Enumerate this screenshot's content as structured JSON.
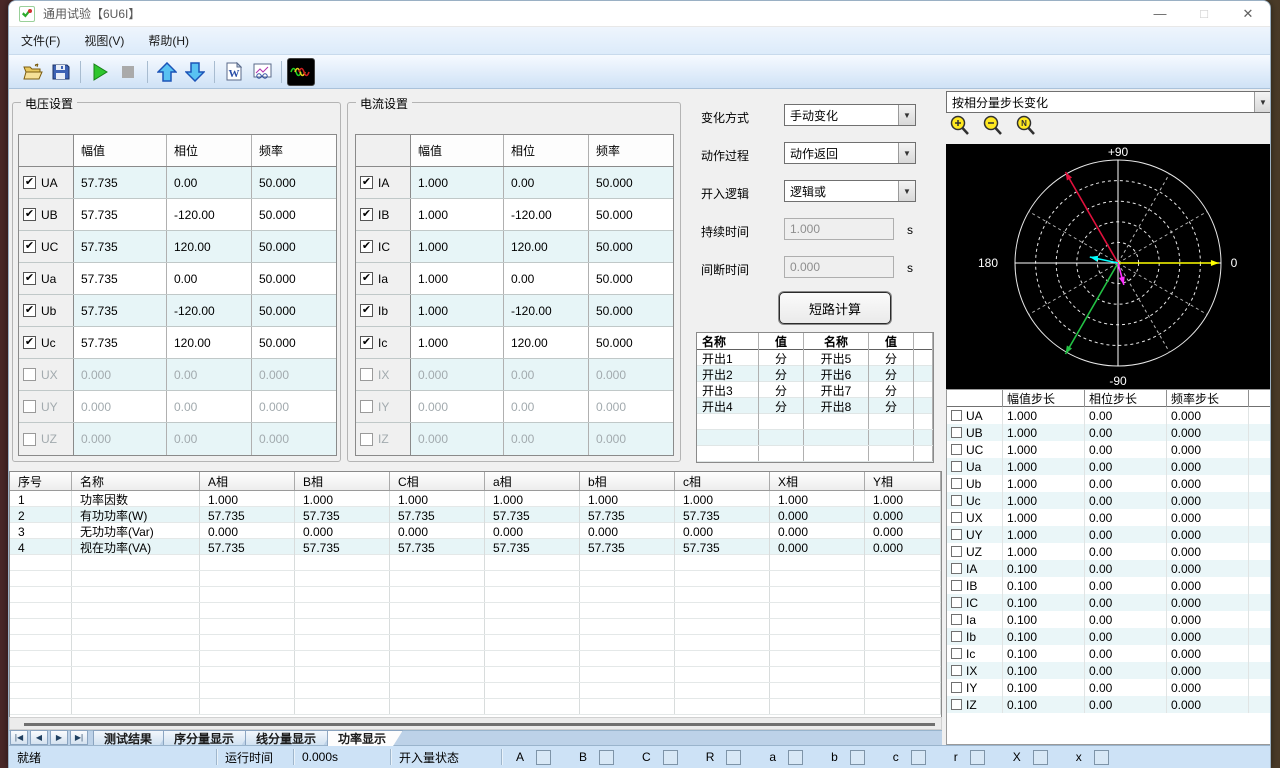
{
  "window": {
    "title": "通用试验【6U6I】",
    "minimize": "—",
    "maximize": "□",
    "close": "✕"
  },
  "menu": {
    "items": [
      "文件(F)",
      "视图(V)",
      "帮助(H)"
    ]
  },
  "toolbar": {
    "icons": [
      "open",
      "save",
      "start",
      "stop",
      "move-up",
      "move-down",
      "word-report",
      "report-view",
      "waveform"
    ]
  },
  "voltage": {
    "group_title": "电压设置",
    "headers": [
      "幅值",
      "相位",
      "频率"
    ],
    "rows": [
      {
        "name": "UA",
        "checked": true,
        "amp": "57.735",
        "phase": "0.00",
        "freq": "50.000"
      },
      {
        "name": "UB",
        "checked": true,
        "amp": "57.735",
        "phase": "-120.00",
        "freq": "50.000"
      },
      {
        "name": "UC",
        "checked": true,
        "amp": "57.735",
        "phase": "120.00",
        "freq": "50.000"
      },
      {
        "name": "Ua",
        "checked": true,
        "amp": "57.735",
        "phase": "0.00",
        "freq": "50.000"
      },
      {
        "name": "Ub",
        "checked": true,
        "amp": "57.735",
        "phase": "-120.00",
        "freq": "50.000"
      },
      {
        "name": "Uc",
        "checked": true,
        "amp": "57.735",
        "phase": "120.00",
        "freq": "50.000"
      },
      {
        "name": "UX",
        "checked": false,
        "amp": "0.000",
        "phase": "0.00",
        "freq": "0.000"
      },
      {
        "name": "UY",
        "checked": false,
        "amp": "0.000",
        "phase": "0.00",
        "freq": "0.000"
      },
      {
        "name": "UZ",
        "checked": false,
        "amp": "0.000",
        "phase": "0.00",
        "freq": "0.000"
      }
    ]
  },
  "current": {
    "group_title": "电流设置",
    "headers": [
      "幅值",
      "相位",
      "频率"
    ],
    "rows": [
      {
        "name": "IA",
        "checked": true,
        "amp": "1.000",
        "phase": "0.00",
        "freq": "50.000"
      },
      {
        "name": "IB",
        "checked": true,
        "amp": "1.000",
        "phase": "-120.00",
        "freq": "50.000"
      },
      {
        "name": "IC",
        "checked": true,
        "amp": "1.000",
        "phase": "120.00",
        "freq": "50.000"
      },
      {
        "name": "Ia",
        "checked": true,
        "amp": "1.000",
        "phase": "0.00",
        "freq": "50.000"
      },
      {
        "name": "Ib",
        "checked": true,
        "amp": "1.000",
        "phase": "-120.00",
        "freq": "50.000"
      },
      {
        "name": "Ic",
        "checked": true,
        "amp": "1.000",
        "phase": "120.00",
        "freq": "50.000"
      },
      {
        "name": "IX",
        "checked": false,
        "amp": "0.000",
        "phase": "0.00",
        "freq": "0.000"
      },
      {
        "name": "IY",
        "checked": false,
        "amp": "0.000",
        "phase": "0.00",
        "freq": "0.000"
      },
      {
        "name": "IZ",
        "checked": false,
        "amp": "0.000",
        "phase": "0.00",
        "freq": "0.000"
      }
    ]
  },
  "controls": {
    "change_mode_label": "变化方式",
    "change_mode_value": "手动变化",
    "action_process_label": "动作过程",
    "action_process_value": "动作返回",
    "di_logic_label": "开入逻辑",
    "di_logic_value": "逻辑或",
    "duration_label": "持续时间",
    "duration_value": "1.000",
    "duration_unit": "s",
    "interval_label": "间断时间",
    "interval_value": "0.000",
    "interval_unit": "s",
    "calc_button": "短路计算"
  },
  "do_table": {
    "headers": [
      "名称",
      "值",
      "名称",
      "值"
    ],
    "rows": [
      [
        "开出1",
        "分",
        "开出5",
        "分"
      ],
      [
        "开出2",
        "分",
        "开出6",
        "分"
      ],
      [
        "开出3",
        "分",
        "开出7",
        "分"
      ],
      [
        "开出4",
        "分",
        "开出8",
        "分"
      ],
      [
        "",
        "",
        "",
        ""
      ],
      [
        "",
        "",
        "",
        ""
      ],
      [
        "",
        "",
        "",
        ""
      ]
    ]
  },
  "right_panel": {
    "dropdown_value": "按相分量步长变化",
    "zoom_icons": [
      "zoom-in",
      "zoom-out",
      "zoom-reset"
    ]
  },
  "chart_data": {
    "type": "phasor-polar",
    "axis_labels": {
      "top": "+90",
      "bottom": "-90",
      "left": "180",
      "right": "0"
    },
    "grid": {
      "dashed_rings": 4,
      "radial_step_deg": 30
    },
    "vectors": [
      {
        "name": "voltage-yellow",
        "color": "#ffff00",
        "angle_deg": 0,
        "magnitude": 57.735,
        "length_frac": 0.49
      },
      {
        "name": "voltage-red",
        "color": "#e0103c",
        "angle_deg": 120,
        "magnitude": 57.735,
        "length_frac": 0.51
      },
      {
        "name": "voltage-green",
        "color": "#22c244",
        "angle_deg": -120,
        "magnitude": 57.735,
        "length_frac": 0.51
      },
      {
        "name": "current-cyan",
        "color": "#00ffff",
        "angle_deg": 168,
        "magnitude": 1.0,
        "length_frac": 0.14
      },
      {
        "name": "current-magenta",
        "color": "#ff30ff",
        "angle_deg": -75,
        "magnitude": 1.0,
        "length_frac": 0.11
      }
    ]
  },
  "step_table": {
    "headers": [
      "幅值步长",
      "相位步长",
      "频率步长"
    ],
    "rows": [
      {
        "name": "UA",
        "amp": "1.000",
        "phase": "0.00",
        "freq": "0.000"
      },
      {
        "name": "UB",
        "amp": "1.000",
        "phase": "0.00",
        "freq": "0.000"
      },
      {
        "name": "UC",
        "amp": "1.000",
        "phase": "0.00",
        "freq": "0.000"
      },
      {
        "name": "Ua",
        "amp": "1.000",
        "phase": "0.00",
        "freq": "0.000"
      },
      {
        "name": "Ub",
        "amp": "1.000",
        "phase": "0.00",
        "freq": "0.000"
      },
      {
        "name": "Uc",
        "amp": "1.000",
        "phase": "0.00",
        "freq": "0.000"
      },
      {
        "name": "UX",
        "amp": "1.000",
        "phase": "0.00",
        "freq": "0.000"
      },
      {
        "name": "UY",
        "amp": "1.000",
        "phase": "0.00",
        "freq": "0.000"
      },
      {
        "name": "UZ",
        "amp": "1.000",
        "phase": "0.00",
        "freq": "0.000"
      },
      {
        "name": "IA",
        "amp": "0.100",
        "phase": "0.00",
        "freq": "0.000"
      },
      {
        "name": "IB",
        "amp": "0.100",
        "phase": "0.00",
        "freq": "0.000"
      },
      {
        "name": "IC",
        "amp": "0.100",
        "phase": "0.00",
        "freq": "0.000"
      },
      {
        "name": "Ia",
        "amp": "0.100",
        "phase": "0.00",
        "freq": "0.000"
      },
      {
        "name": "Ib",
        "amp": "0.100",
        "phase": "0.00",
        "freq": "0.000"
      },
      {
        "name": "Ic",
        "amp": "0.100",
        "phase": "0.00",
        "freq": "0.000"
      },
      {
        "name": "IX",
        "amp": "0.100",
        "phase": "0.00",
        "freq": "0.000"
      },
      {
        "name": "IY",
        "amp": "0.100",
        "phase": "0.00",
        "freq": "0.000"
      },
      {
        "name": "IZ",
        "amp": "0.100",
        "phase": "0.00",
        "freq": "0.000"
      }
    ]
  },
  "power_table": {
    "headers": [
      "序号",
      "名称",
      "A相",
      "B相",
      "C相",
      "a相",
      "b相",
      "c相",
      "X相",
      "Y相"
    ],
    "rows": [
      [
        "1",
        "功率因数",
        "1.000",
        "1.000",
        "1.000",
        "1.000",
        "1.000",
        "1.000",
        "1.000",
        "1.000"
      ],
      [
        "2",
        "有功功率(W)",
        "57.735",
        "57.735",
        "57.735",
        "57.735",
        "57.735",
        "57.735",
        "0.000",
        "0.000"
      ],
      [
        "3",
        "无功功率(Var)",
        "0.000",
        "0.000",
        "0.000",
        "0.000",
        "0.000",
        "0.000",
        "0.000",
        "0.000"
      ],
      [
        "4",
        "视在功率(VA)",
        "57.735",
        "57.735",
        "57.735",
        "57.735",
        "57.735",
        "57.735",
        "0.000",
        "0.000"
      ]
    ]
  },
  "tabs": {
    "nav": [
      "|◀",
      "◀",
      "▶",
      "▶|"
    ],
    "items": [
      "测试结果",
      "序分量显示",
      "线分量显示",
      "功率显示"
    ],
    "active": "功率显示"
  },
  "statusbar": {
    "ready": "就绪",
    "runtime_label": "运行时间",
    "runtime_value": "0.000s",
    "di_state_label": "开入量状态",
    "indicators": [
      "A",
      "B",
      "C",
      "R",
      "a",
      "b",
      "c",
      "r",
      "X",
      "x"
    ]
  }
}
